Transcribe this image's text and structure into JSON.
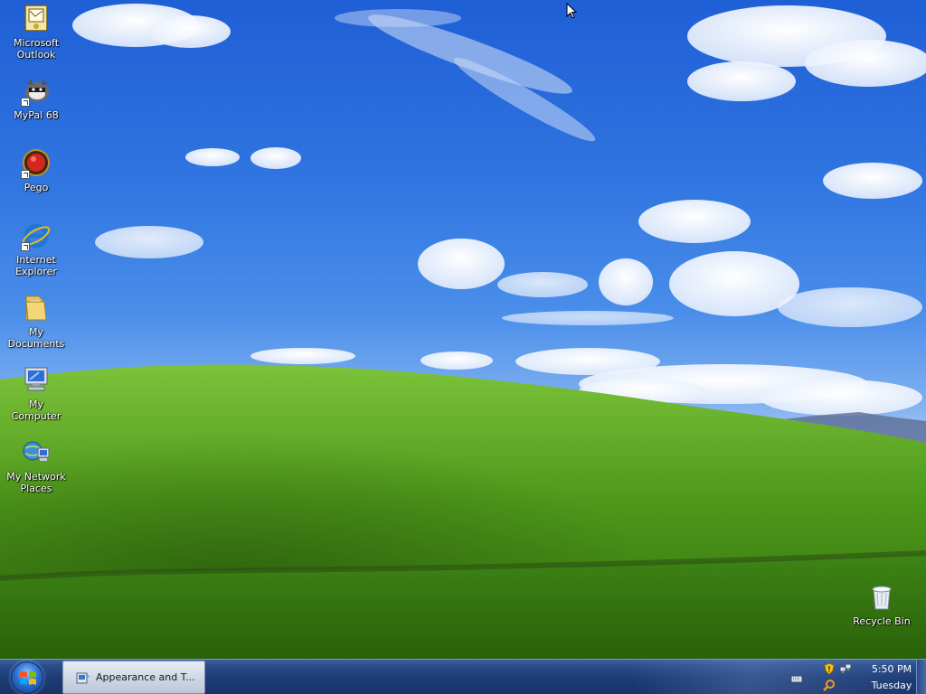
{
  "desktop": {
    "icons": [
      {
        "label": "Microsoft\nOutlook",
        "icon": "outlook-icon"
      },
      {
        "label": "MyPal 68",
        "icon": "mypal-icon"
      },
      {
        "label": "Pego",
        "icon": "pego-icon"
      },
      {
        "label": "Internet\nExplorer",
        "icon": "internet-explorer-icon"
      },
      {
        "label": "My\nDocuments",
        "icon": "folder-icon"
      },
      {
        "label": "My Computer",
        "icon": "computer-icon"
      },
      {
        "label": "My Network\nPlaces",
        "icon": "network-icon"
      }
    ],
    "recycle_bin": {
      "label": "Recycle Bin",
      "icon": "recycle-bin-icon"
    }
  },
  "taskbar": {
    "start_icon": "windows-logo-icon",
    "active_task": {
      "label": "Appearance and T...",
      "icon": "control-panel-icon"
    },
    "tray": {
      "icons": [
        "keyboard-icon",
        "security-shield-icon",
        "network-tray-icon",
        "search-tray-icon"
      ],
      "time": "5:50 PM",
      "day": "Tuesday"
    }
  },
  "colors": {
    "sky": "#2f74e0",
    "grass": "#4f9a1c",
    "taskbar": "#1d3b75"
  }
}
